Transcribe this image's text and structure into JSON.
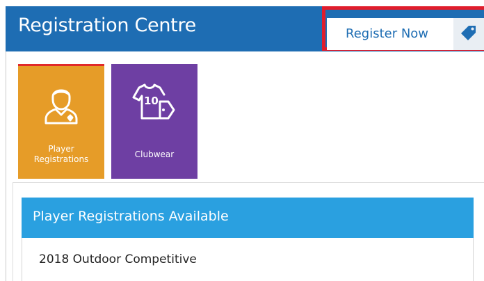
{
  "header": {
    "title": "Registration Centre",
    "register_button_label": "Register Now",
    "register_icon": "tag-icon",
    "highlight_color": "#e01d2c",
    "brand_color": "#1e6db3"
  },
  "tiles": [
    {
      "label_line1": "Player",
      "label_line2": "Registrations",
      "icon": "player-icon",
      "color": "#e69c28",
      "selected": true
    },
    {
      "label_line1": "Clubwear",
      "icon": "jersey-tag-icon",
      "color": "#6e3fa3",
      "selected": false
    }
  ],
  "available": {
    "title": "Player Registrations Available",
    "color": "#2aa0e0",
    "items": [
      {
        "label": "2018 Outdoor Competitive"
      }
    ]
  }
}
